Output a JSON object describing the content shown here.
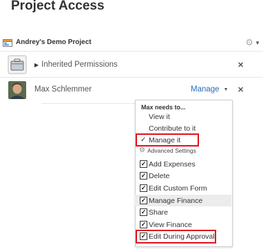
{
  "header": {
    "title": "Project Access"
  },
  "project": {
    "name": "Andrey's Demo Project"
  },
  "inherited": {
    "label": "Inherited Permissions"
  },
  "user": {
    "name": "Max Schlemmer",
    "role_label": "Manage"
  },
  "menu": {
    "heading": "Max needs to...",
    "roles": [
      {
        "label": "View it",
        "selected": false
      },
      {
        "label": "Contribute to it",
        "selected": false
      },
      {
        "label": "Manage it",
        "selected": true
      }
    ],
    "advanced_label": "Advanced Settings",
    "permissions": [
      {
        "label": "Add Expenses",
        "checked": true
      },
      {
        "label": "Delete",
        "checked": true
      },
      {
        "label": "Edit Custom Form",
        "checked": true
      },
      {
        "label": "Manage Finance",
        "checked": true
      },
      {
        "label": "Share",
        "checked": true
      },
      {
        "label": "View Finance",
        "checked": true
      },
      {
        "label": "Edit During Approval",
        "checked": true
      }
    ]
  },
  "colors": {
    "link": "#2a6ebb",
    "highlight": "#e0101a"
  }
}
